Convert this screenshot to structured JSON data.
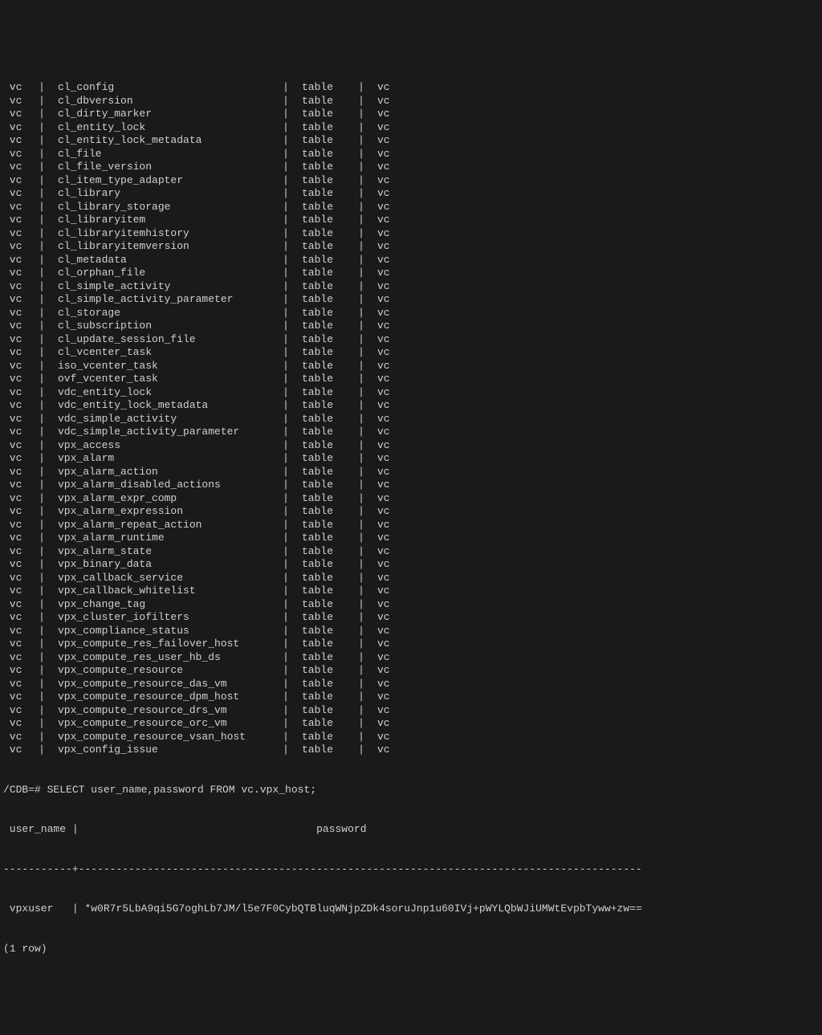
{
  "table_list": {
    "schema": "vc",
    "type": "table",
    "owner": "vc",
    "separator": "|",
    "names": [
      "cl_config",
      "cl_dbversion",
      "cl_dirty_marker",
      "cl_entity_lock",
      "cl_entity_lock_metadata",
      "cl_file",
      "cl_file_version",
      "cl_item_type_adapter",
      "cl_library",
      "cl_library_storage",
      "cl_libraryitem",
      "cl_libraryitemhistory",
      "cl_libraryitemversion",
      "cl_metadata",
      "cl_orphan_file",
      "cl_simple_activity",
      "cl_simple_activity_parameter",
      "cl_storage",
      "cl_subscription",
      "cl_update_session_file",
      "cl_vcenter_task",
      "iso_vcenter_task",
      "ovf_vcenter_task",
      "vdc_entity_lock",
      "vdc_entity_lock_metadata",
      "vdc_simple_activity",
      "vdc_simple_activity_parameter",
      "vpx_access",
      "vpx_alarm",
      "vpx_alarm_action",
      "vpx_alarm_disabled_actions",
      "vpx_alarm_expr_comp",
      "vpx_alarm_expression",
      "vpx_alarm_repeat_action",
      "vpx_alarm_runtime",
      "vpx_alarm_state",
      "vpx_binary_data",
      "vpx_callback_service",
      "vpx_callback_whitelist",
      "vpx_change_tag",
      "vpx_cluster_iofilters",
      "vpx_compliance_status",
      "vpx_compute_res_failover_host",
      "vpx_compute_res_user_hb_ds",
      "vpx_compute_resource",
      "vpx_compute_resource_das_vm",
      "vpx_compute_resource_dpm_host",
      "vpx_compute_resource_drs_vm",
      "vpx_compute_resource_orc_vm",
      "vpx_compute_resource_vsan_host",
      "vpx_config_issue"
    ]
  },
  "query": {
    "prompt": "/CDB=# ",
    "statement": "SELECT user_name,password FROM vc.vpx_host;",
    "header": {
      "col1": " user_name ",
      "sep": "|",
      "col2": "                                      password"
    },
    "divider": "-----------+------------------------------------------------------------------------------------------",
    "result_row": {
      "col1": " vpxuser   ",
      "sep": "|",
      "col2": " *w0R7r5LbA9qi5G7oghLb7JM/l5e7F0CybQTBluqWNjpZDk4soruJnp1u60IVj+pWYLQbWJiUMWtEvpbTyww+zw=="
    },
    "footer": "(1 row)"
  }
}
